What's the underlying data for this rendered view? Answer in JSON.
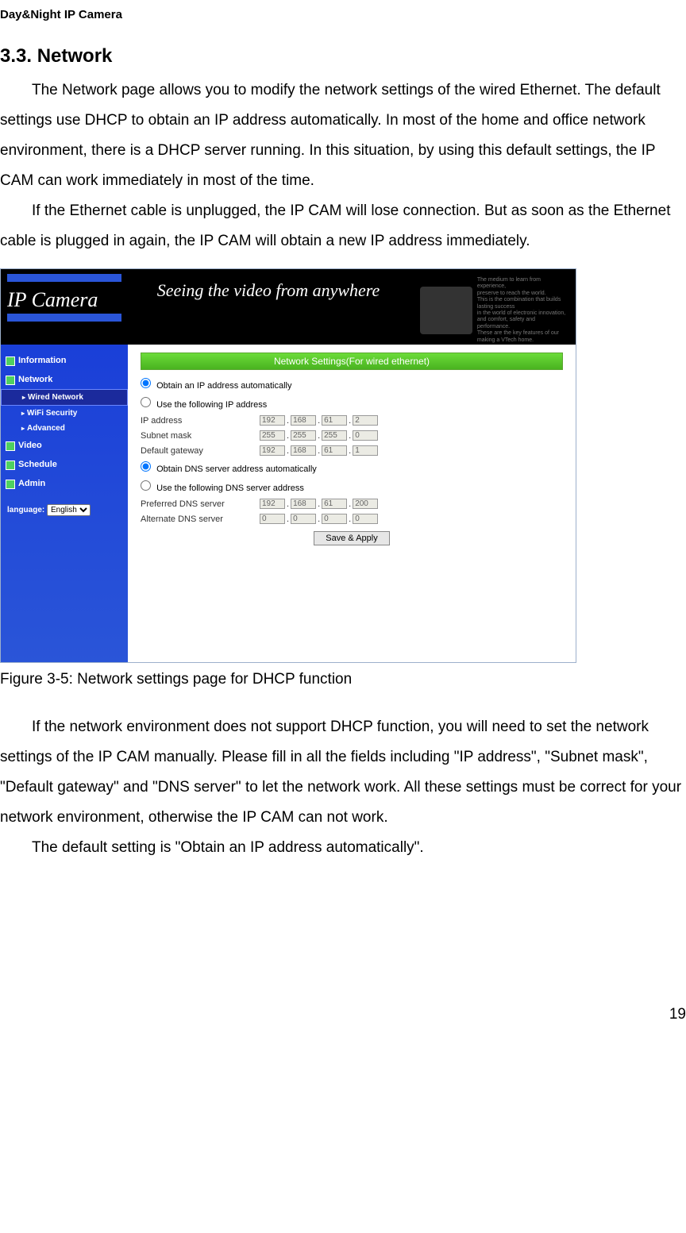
{
  "doc_header": "Day&Night IP Camera",
  "section_heading": "3.3. Network",
  "paragraph1": "The Network page allows you to modify the network settings of the wired Ethernet. The default settings use DHCP to obtain an IP address automatically. In most of the home and office network environment, there is a DHCP server running. In this situation, by using this default settings, the IP CAM can work immediately in most of the time.",
  "paragraph2": "If the Ethernet cable is unplugged, the IP CAM will lose connection. But as soon as the Ethernet cable is plugged in again, the IP CAM will obtain a new IP address immediately.",
  "figure_caption": "Figure 3-5: Network settings page for DHCP function",
  "paragraph3": "If the network environment does not support DHCP function, you will need to set the network settings of the IP CAM manually. Please fill in all the fields including \"IP address\", \"Subnet mask\", \"Default gateway\" and \"DNS server\" to let the network work. All these settings must be correct for your network environment, otherwise the IP CAM can not work.",
  "paragraph4": "The default setting is \"Obtain an IP address automatically\".",
  "page_number": "19",
  "screenshot": {
    "logo_text": "IP Camera",
    "banner_tag": "Seeing the video from anywhere",
    "nav": {
      "information": "Information",
      "network": "Network",
      "wired_network": "Wired Network",
      "wifi_security": "WiFi Security",
      "advanced": "Advanced",
      "video": "Video",
      "schedule": "Schedule",
      "admin": "Admin",
      "language_label": "language:",
      "language_value": "English"
    },
    "panel": {
      "title": "Network Settings(For wired ethernet)",
      "radio_auto_ip": "Obtain an IP address automatically",
      "radio_static_ip": "Use the following IP address",
      "label_ip": "IP address",
      "ip": [
        "192",
        "168",
        "61",
        "2"
      ],
      "label_subnet": "Subnet mask",
      "subnet": [
        "255",
        "255",
        "255",
        "0"
      ],
      "label_gateway": "Default gateway",
      "gateway": [
        "192",
        "168",
        "61",
        "1"
      ],
      "radio_auto_dns": "Obtain DNS server address automatically",
      "radio_static_dns": "Use the following DNS server address",
      "label_pref_dns": "Preferred DNS server",
      "pref_dns": [
        "192",
        "168",
        "61",
        "200"
      ],
      "label_alt_dns": "Alternate DNS server",
      "alt_dns": [
        "0",
        "0",
        "0",
        "0"
      ],
      "save_apply": "Save & Apply"
    }
  }
}
